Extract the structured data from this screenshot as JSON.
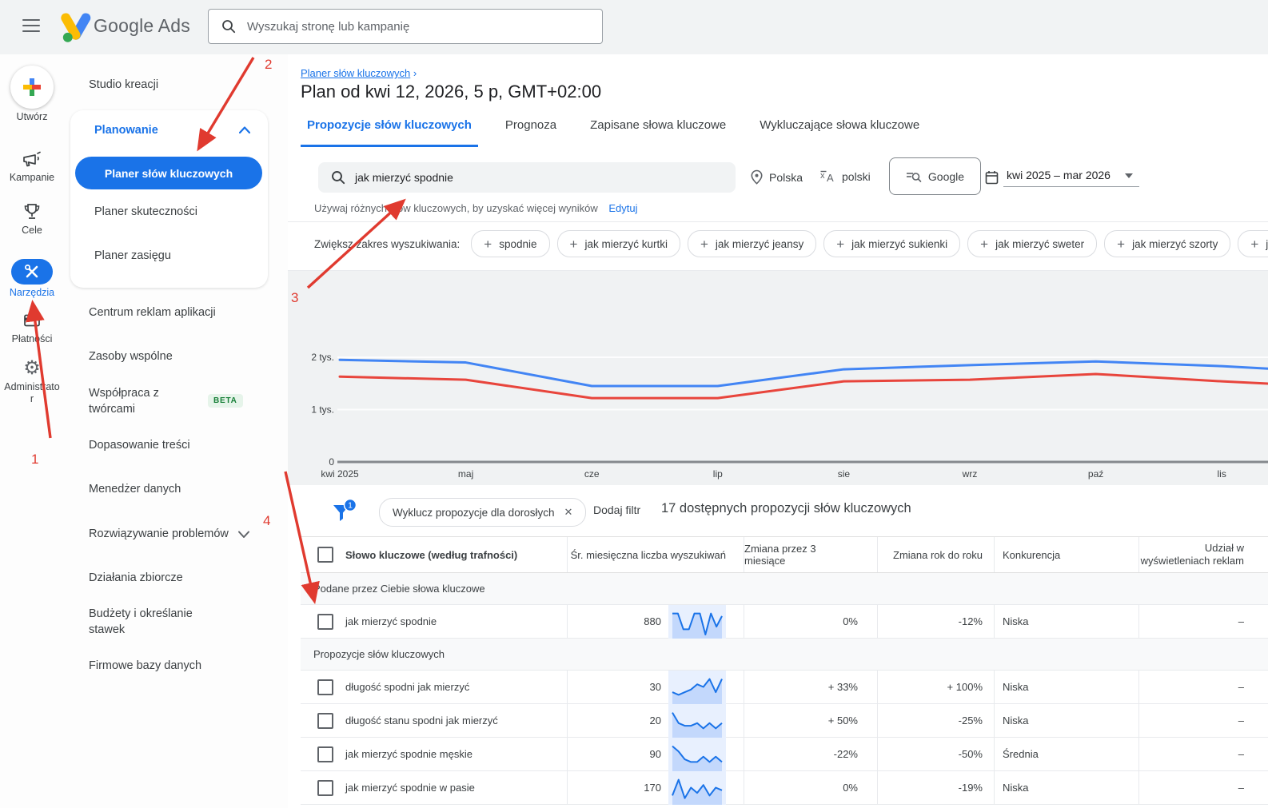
{
  "topbar": {
    "brand": "Google Ads",
    "search_placeholder": "Wyszukaj stronę lub kampanię"
  },
  "rail": {
    "items": [
      {
        "label": "Utwórz"
      },
      {
        "label": "Kampanie"
      },
      {
        "label": "Cele"
      },
      {
        "label": "Narzędzia",
        "selected": true
      },
      {
        "label": "Płatności"
      },
      {
        "label": "Administrator"
      }
    ]
  },
  "sidebar": {
    "studio": "Studio kreacji",
    "planning_group": {
      "label": "Planowanie",
      "selected_item": "Planer słów kluczowych",
      "item2": "Planer skuteczności",
      "item3": "Planer zasięgu"
    },
    "items": [
      {
        "label": "Centrum reklam aplikacji"
      },
      {
        "label": "Zasoby wspólne",
        "chevron": true
      },
      {
        "label": "Współpraca z twórcami",
        "badge": "BETA"
      },
      {
        "label": "Dopasowanie treści"
      },
      {
        "label": "Menedżer danych"
      },
      {
        "label": "Rozwiązywanie problemów",
        "chevron": true
      },
      {
        "label": "Działania zbiorcze",
        "chevron": true
      },
      {
        "label": "Budżety i określanie stawek",
        "chevron": true
      },
      {
        "label": "Firmowe bazy danych"
      }
    ]
  },
  "header": {
    "breadcrumb": "Planer słów kluczowych",
    "breadcrumb_sep": "›",
    "title": "Plan od kwi 12, 2026, 5 p, GMT+02:00"
  },
  "tabs": [
    {
      "label": "Propozycje słów kluczowych",
      "active": true
    },
    {
      "label": "Prognoza"
    },
    {
      "label": "Zapisane słowa kluczowe"
    },
    {
      "label": "Wykluczające słowa kluczowe"
    }
  ],
  "controls": {
    "keyword": "jak mierzyć spodnie",
    "location": "Polska",
    "language": "polski",
    "network": "Google",
    "date_range": "kwi 2025 – mar 2026",
    "hint": "Używaj różnych słów kluczowych, by uzyskać więcej wyników",
    "hint_action": "Edytuj",
    "broaden_label": "Zwiększ zakres wyszukiwania:",
    "chips": [
      "spodnie",
      "jak mierzyć kurtki",
      "jak mierzyć jeansy",
      "jak mierzyć sukienki",
      "jak mierzyć sweter",
      "jak mierzyć szorty",
      "jak mierzyć sp"
    ]
  },
  "chart_data": {
    "type": "line",
    "x": [
      "kwi 2025",
      "maj",
      "cze",
      "lip",
      "sie",
      "wrz",
      "paź",
      "lis"
    ],
    "ylabels": [
      "2 tys.",
      "1 tys.",
      "0"
    ],
    "ylim": [
      0,
      2300
    ],
    "grid": true,
    "legend_position": "none",
    "series": [
      {
        "name": "trend-upper-blue",
        "color": "#4285f4",
        "values": [
          1950,
          1900,
          1450,
          1450,
          1770,
          1850,
          1920,
          1830,
          1700
        ]
      },
      {
        "name": "trend-lower-red",
        "color": "#e8453c",
        "values": [
          1630,
          1570,
          1220,
          1220,
          1540,
          1570,
          1680,
          1540,
          1420
        ]
      }
    ]
  },
  "filterbar": {
    "applied_count": "1",
    "chip": "Wyklucz propozycje dla dorosłych",
    "add_filter": "Dodaj filtr",
    "summary": "17 dostępnych propozycji słów kluczowych"
  },
  "table": {
    "columns": [
      "Słowo kluczowe (według trafności)",
      "Śr. miesięczna liczba wyszukiwań",
      "Zmiana przez 3 miesiące",
      "Zmiana rok do roku",
      "Konkurencja",
      "Udział w wyświetleniach reklam"
    ],
    "sections": [
      {
        "label": "Podane przez Ciebie słowa kluczowe",
        "rows": [
          {
            "keyword": "jak mierzyć spodnie",
            "volume": "880",
            "spark": [
              8,
              8,
              2,
              2,
              8,
              8,
              0,
              8,
              3,
              7
            ],
            "change_3m": "0%",
            "yoy": "-12%",
            "competition": "Niska",
            "ad_share": "–"
          }
        ]
      },
      {
        "label": "Propozycje słów kluczowych",
        "rows": [
          {
            "keyword": "długość spodni jak mierzyć",
            "volume": "30",
            "spark": [
              3,
              2,
              3,
              4,
              6,
              5,
              8,
              3,
              8
            ],
            "change_3m": "+ 33%",
            "yoy": "+ 100%",
            "competition": "Niska",
            "ad_share": "–"
          },
          {
            "keyword": "długość stanu spodni jak mierzyć",
            "volume": "20",
            "spark": [
              8,
              4,
              3,
              3,
              4,
              2,
              4,
              2,
              4
            ],
            "change_3m": "+ 50%",
            "yoy": "-25%",
            "competition": "Niska",
            "ad_share": "–"
          },
          {
            "keyword": "jak mierzyć spodnie męskie",
            "volume": "90",
            "spark": [
              8,
              6,
              3,
              2,
              2,
              4,
              2,
              4,
              2
            ],
            "change_3m": "-22%",
            "yoy": "-50%",
            "competition": "Średnia",
            "ad_share": "–"
          },
          {
            "keyword": "jak mierzyć spodnie w pasie",
            "volume": "170",
            "spark": [
              2,
              8,
              1,
              5,
              3,
              6,
              2,
              5,
              4
            ],
            "change_3m": "0%",
            "yoy": "-19%",
            "competition": "Niska",
            "ad_share": "–"
          }
        ]
      }
    ]
  },
  "annotations": {
    "labels": [
      "1",
      "2",
      "3",
      "4"
    ],
    "color": "#e03a2f"
  },
  "icons": {
    "plus": "+",
    "close": "✕",
    "gear": "⚙"
  },
  "colors": {
    "accent": "#1a73e8",
    "chart_blue": "#4285f4",
    "chart_red": "#e8453c",
    "beta_green": "#188038",
    "band_bg": "#f0f2f3"
  }
}
